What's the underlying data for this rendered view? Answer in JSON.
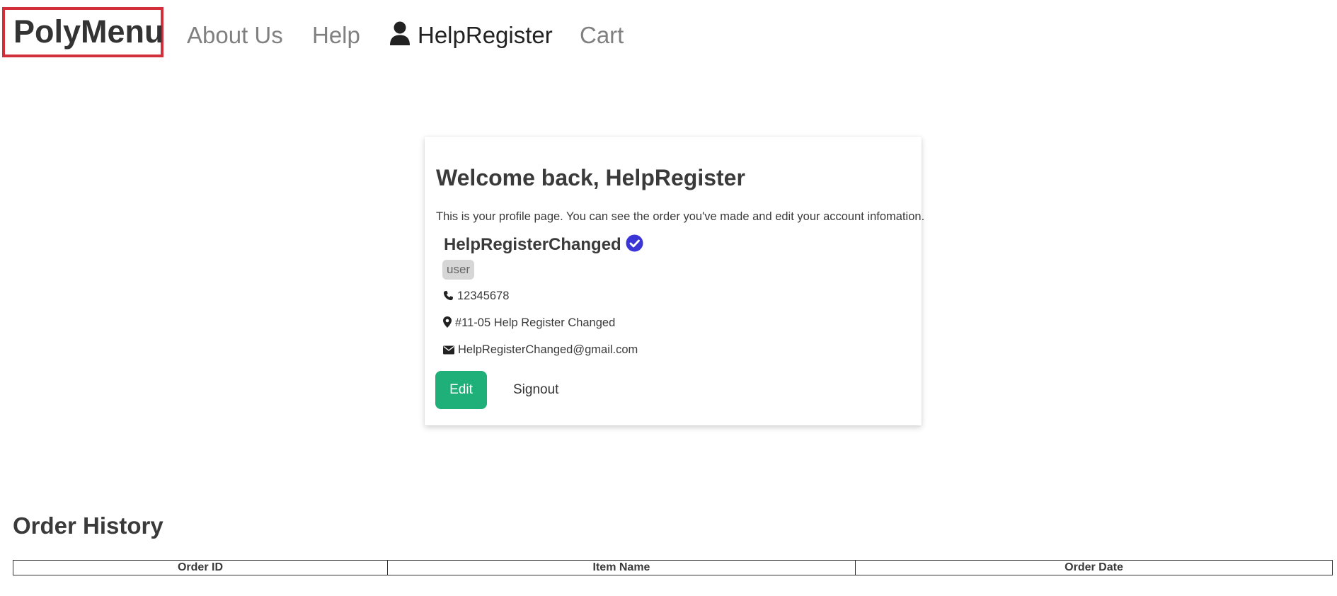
{
  "nav": {
    "brand": "PolyMenu",
    "links": [
      {
        "label": "About Us"
      },
      {
        "label": "Help"
      },
      {
        "label": "HelpRegister",
        "icon": "user-icon"
      },
      {
        "label": "Cart"
      }
    ]
  },
  "profile": {
    "title": "Welcome back, HelpRegister",
    "description": "This is your profile page. You can see the order you've made and edit your account infomation.",
    "name": "HelpRegisterChanged",
    "verified_icon": "verified-check-icon",
    "role": "user",
    "phone": "12345678",
    "address": "#11-05 Help Register Changed",
    "email": "HelpRegisterChanged@gmail.com",
    "edit_label": "Edit",
    "signout_label": "Signout"
  },
  "orders": {
    "title": "Order History",
    "columns": [
      "Order ID",
      "Item Name",
      "Order Date"
    ],
    "rows": []
  },
  "colors": {
    "brand_border": "#d32f3a",
    "edit_button": "#1fb079",
    "verified_badge": "#3b34d6",
    "role_badge_bg": "#d6d6d6"
  }
}
